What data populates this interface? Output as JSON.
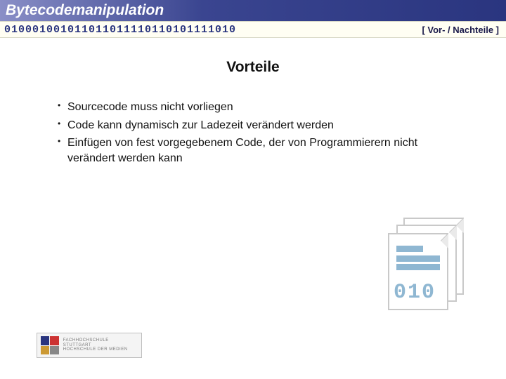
{
  "header": {
    "title": "Bytecodemanipulation",
    "bits": "010001001011011011110110101111010",
    "section_label": "[ Vor- / Nachteile ]"
  },
  "content": {
    "heading": "Vorteile",
    "bullets": [
      "Sourcecode muss nicht vorliegen",
      "Code kann dynamisch zur Ladezeit verändert werden",
      "Einfügen von fest vorgegebenem Code, der von Programmierern nicht verändert werden kann"
    ]
  },
  "illustration": {
    "digits": "010"
  },
  "footer": {
    "logo_line1": "FACHHOCHSCHULE STUTTGART",
    "logo_line2": "HOCHSCHULE DER MEDIEN"
  }
}
